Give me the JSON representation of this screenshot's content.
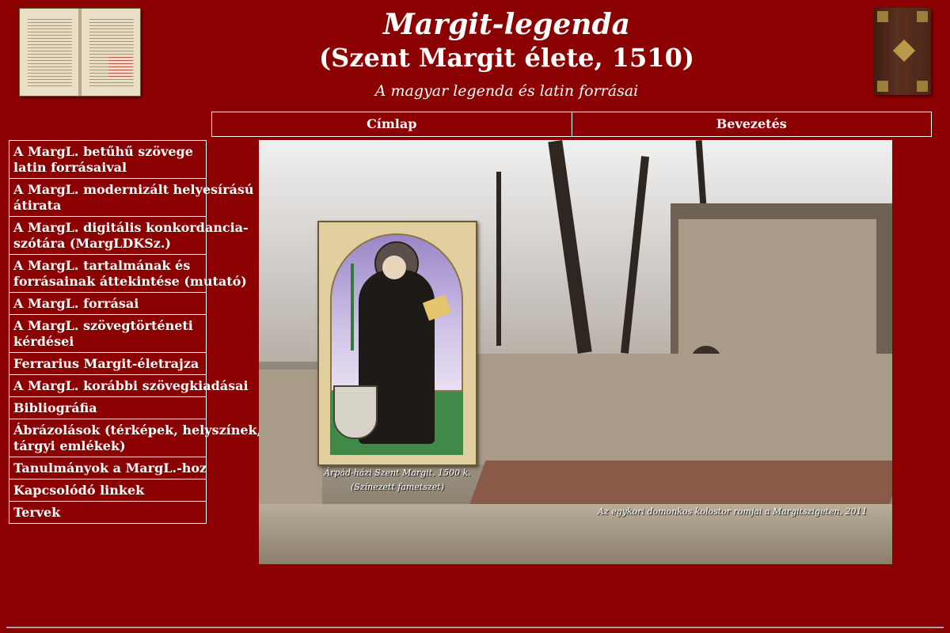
{
  "header": {
    "title": "Margit-legenda",
    "subtitle": "(Szent Margit élete, 1510)",
    "tagline": "A magyar legenda és latin forrásai"
  },
  "topnav": {
    "items": [
      {
        "label": "Címlap"
      },
      {
        "label": "Bevezetés"
      }
    ]
  },
  "sidebar": {
    "items": [
      {
        "lines": [
          "A MargL. betűhű szövege",
          "latin forrásaival"
        ]
      },
      {
        "lines": [
          "A MargL. modernizált helyesírású",
          "átirata"
        ]
      },
      {
        "lines": [
          "A MargL. digitális konkordancia-",
          "szótára (MargLDKSz.)"
        ]
      },
      {
        "lines": [
          "A MargL. tartalmának és",
          "forrásainak áttekintése (mutató)"
        ]
      },
      {
        "lines": [
          "A MargL. forrásai"
        ]
      },
      {
        "lines": [
          "A MargL. szövegtörténeti",
          "kérdései"
        ]
      },
      {
        "lines": [
          "Ferrarius Margit-életrajza"
        ]
      },
      {
        "lines": [
          "A MargL. korábbi szövegkiadásai"
        ]
      },
      {
        "lines": [
          "Bibliográfia"
        ]
      },
      {
        "lines": [
          "Ábrázolások (térképek, helyszínek,",
          "tárgyi emlékek)"
        ]
      },
      {
        "lines": [
          "Tanulmányok a MargL.-hoz"
        ]
      },
      {
        "lines": [
          "Kapcsolódó linkek"
        ]
      },
      {
        "lines": [
          "Tervek"
        ]
      }
    ]
  },
  "photo": {
    "caption_saint_line1": "Árpád-házi Szent Margit, 1500 k.",
    "caption_saint_line2": "(Színezett fametszet)",
    "caption_ruins": "Az egykori domonkos kolostor romjai a Margitszigeten, 2011"
  },
  "icons": {
    "left_logo": "open-codex-image",
    "right_logo": "bound-book-image"
  },
  "colors": {
    "background": "#8b0000",
    "text": "#ffffff",
    "border": "#ffffff"
  }
}
